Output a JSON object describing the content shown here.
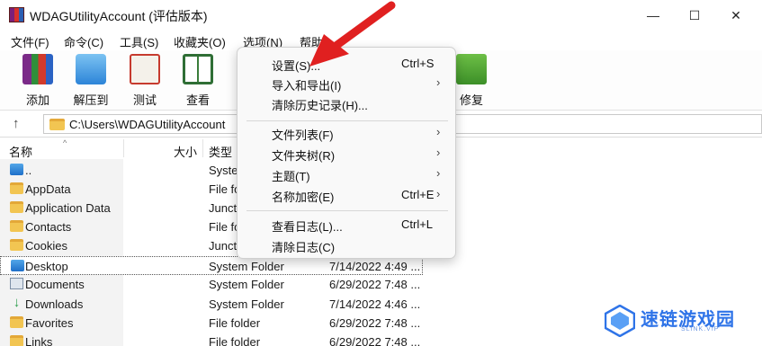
{
  "window": {
    "title": "WDAGUtilityAccount (评估版本)",
    "minimize_glyph": "—",
    "maximize_glyph": "☐",
    "close_glyph": "✕"
  },
  "menubar": {
    "items": [
      "文件(F)",
      "命令(C)",
      "工具(S)",
      "收藏夹(O)",
      "选项(N)",
      "帮助"
    ]
  },
  "toolbar": {
    "buttons": [
      {
        "label": "添加",
        "icon": "archive-books-icon"
      },
      {
        "label": "解压到",
        "icon": "extract-folder-icon"
      },
      {
        "label": "测试",
        "icon": "test-clipboard-icon"
      },
      {
        "label": "查看",
        "icon": "view-book-icon"
      },
      {
        "label": "修复",
        "icon": "repair-box-icon"
      }
    ]
  },
  "address": {
    "path": "C:\\Users\\WDAGUtilityAccount"
  },
  "filelist": {
    "headers": {
      "name": "名称",
      "size": "大小",
      "type": "类型"
    },
    "rows": [
      {
        "name": "..",
        "type": "Syste",
        "modified": "",
        "icon": "parent-folder-icon"
      },
      {
        "name": "AppData",
        "type": "File fo",
        "modified": "",
        "icon": "folder-icon"
      },
      {
        "name": "Application Data",
        "type": "Juncti",
        "modified": "",
        "icon": "folder-icon"
      },
      {
        "name": "Contacts",
        "type": "File fo",
        "modified": "",
        "icon": "folder-icon"
      },
      {
        "name": "Cookies",
        "type": "Juncti",
        "modified": "",
        "icon": "folder-icon"
      },
      {
        "name": "Desktop",
        "type": "System Folder",
        "modified": "7/14/2022 4:49 ...",
        "icon": "desktop-folder-icon"
      },
      {
        "name": "Documents",
        "type": "System Folder",
        "modified": "6/29/2022 7:48 ...",
        "icon": "documents-folder-icon"
      },
      {
        "name": "Downloads",
        "type": "System Folder",
        "modified": "7/14/2022 4:46 ...",
        "icon": "downloads-folder-icon"
      },
      {
        "name": "Favorites",
        "type": "File folder",
        "modified": "6/29/2022 7:48 ...",
        "icon": "folder-icon"
      },
      {
        "name": "Links",
        "type": "File folder",
        "modified": "6/29/2022 7:48 ...",
        "icon": "folder-icon"
      }
    ]
  },
  "context_menu": {
    "items": [
      {
        "label": "设置(S)...",
        "shortcut": "Ctrl+S",
        "submenu": false
      },
      {
        "label": "导入和导出(I)",
        "shortcut": "",
        "submenu": true
      },
      {
        "label": "清除历史记录(H)...",
        "shortcut": "",
        "submenu": false
      },
      {
        "label": "文件列表(F)",
        "shortcut": "",
        "submenu": true
      },
      {
        "label": "文件夹树(R)",
        "shortcut": "",
        "submenu": true
      },
      {
        "label": "主题(T)",
        "shortcut": "",
        "submenu": true
      },
      {
        "label": "名称加密(E)",
        "shortcut": "Ctrl+E",
        "submenu": true
      },
      {
        "label": "查看日志(L)...",
        "shortcut": "Ctrl+L",
        "submenu": false
      },
      {
        "label": "清除日志(C)",
        "shortcut": "",
        "submenu": false
      }
    ],
    "submenu_glyph": "›"
  },
  "watermark": {
    "text": "速链游戏园",
    "sub": "SLINK.VIP"
  },
  "colors": {
    "annotation_arrow": "#e02020",
    "watermark_blue": "#2f74e8"
  }
}
